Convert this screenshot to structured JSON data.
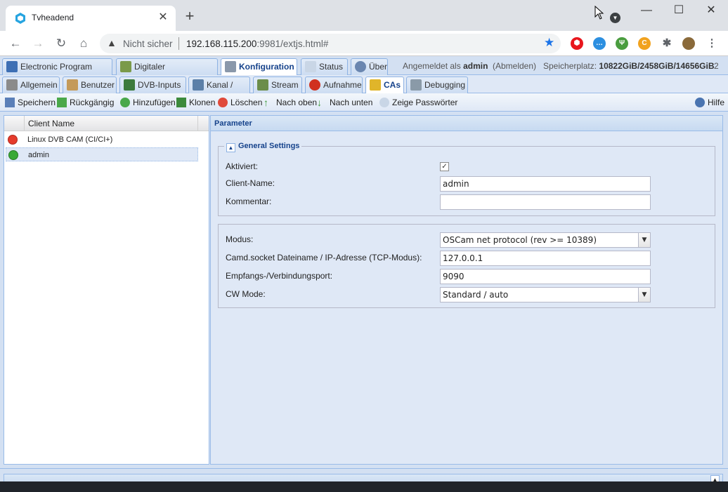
{
  "browser": {
    "tab_title": "Tvheadend",
    "close_glyph": "✕",
    "new_tab_glyph": "+",
    "security_label": "Nicht sicher",
    "url_host": "192.168.115.200",
    "url_rest": ":9981/extjs.html#",
    "window_controls": {
      "minimize": "—",
      "maximize": "☐",
      "close": "✕"
    }
  },
  "main_tabs": [
    {
      "label": "Electronic Program Guide",
      "icon": "epg-icon"
    },
    {
      "label": "Digitaler Videorekorder",
      "icon": "download-icon"
    },
    {
      "label": "Konfiguration",
      "icon": "wrench-icon"
    },
    {
      "label": "Status",
      "icon": "eye-icon"
    },
    {
      "label": "Über",
      "icon": "info-icon"
    }
  ],
  "user": {
    "logged_prefix": "Angemeldet als",
    "username": "admin",
    "logout": "(Abmelden)",
    "storage_label": "Speicherplatz:",
    "storage_value": "10822GiB/2458GiB/14656GiB",
    "storage_trailing": "2"
  },
  "sub_tabs": [
    {
      "label": "Allgemein",
      "icon": "tools-icon"
    },
    {
      "label": "Benutzer",
      "icon": "users-icon"
    },
    {
      "label": "DVB-Inputs",
      "icon": "chip-icon"
    },
    {
      "label": "Kanal / EPG",
      "icon": "tv-icon"
    },
    {
      "label": "Stream",
      "icon": "stream-icon"
    },
    {
      "label": "Aufnahme",
      "icon": "rec-icon"
    },
    {
      "label": "CAs",
      "icon": "key-icon"
    },
    {
      "label": "Debugging",
      "icon": "gears-icon"
    }
  ],
  "actions": [
    {
      "label": "Speichern",
      "icon": "save-icon"
    },
    {
      "label": "Rückgängig",
      "icon": "undo-icon"
    },
    {
      "label": "Hinzufügen",
      "icon": "add-icon"
    },
    {
      "label": "Klonen",
      "icon": "clone-icon"
    },
    {
      "label": "Löschen",
      "icon": "delete-icon"
    },
    {
      "label": "Nach oben",
      "icon": "arrow-up-icon"
    },
    {
      "label": "Nach unten",
      "icon": "arrow-down-icon"
    },
    {
      "label": "Zeige Passwörter",
      "icon": "eye-icon"
    }
  ],
  "help_label": "Hilfe",
  "grid": {
    "column": "Client Name",
    "rows": [
      {
        "name": "Linux DVB CAM (CI/CI+)",
        "status": "error",
        "color": "#e53b2c"
      },
      {
        "name": "admin",
        "status": "ok",
        "color": "#3aa935"
      }
    ]
  },
  "panel": {
    "title": "Parameter",
    "section_title": "General Settings",
    "collapse_glyph": "▲",
    "checkmark": "✓",
    "dropdown_glyph": "▼",
    "fields": {
      "aktiviert_label": "Aktiviert:",
      "aktiviert_value": true,
      "client_name_label": "Client-Name:",
      "client_name_value": "admin",
      "kommentar_label": "Kommentar:",
      "kommentar_value": "",
      "modus_label": "Modus:",
      "modus_value": "OSCam net protocol (rev >= 10389)",
      "camd_label": "Camd.socket Dateiname / IP-Adresse (TCP-Modus):",
      "camd_value": "127.0.0.1",
      "port_label": "Empfangs-/Verbindungsport:",
      "port_value": "9090",
      "cwmode_label": "CW Mode:",
      "cwmode_value": "Standard / auto"
    }
  }
}
